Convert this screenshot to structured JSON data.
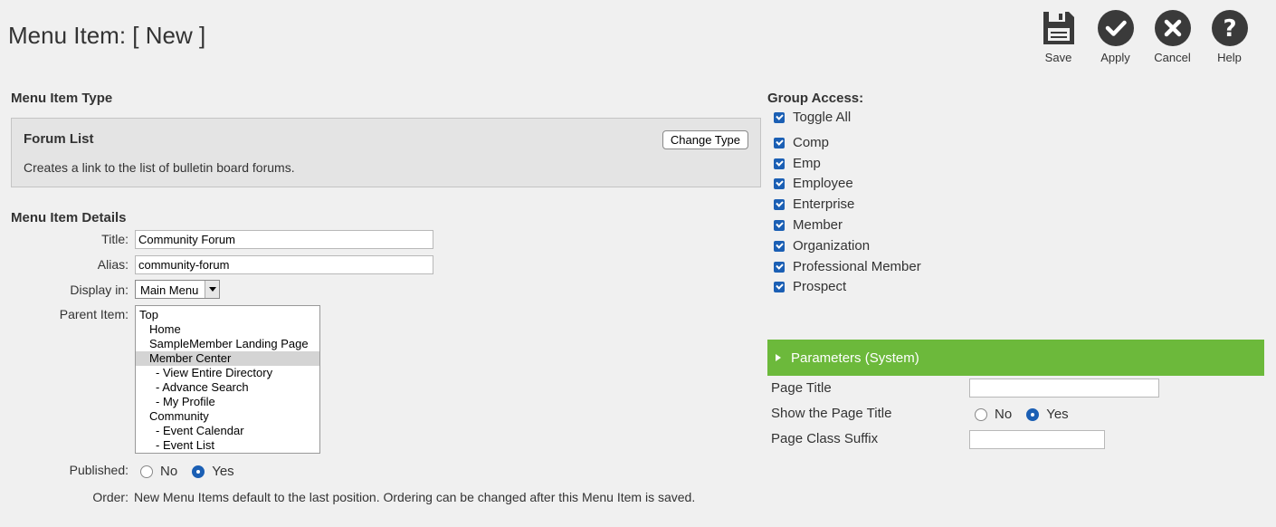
{
  "header": {
    "title": "Menu Item: [ New ]"
  },
  "toolbar": {
    "save": "Save",
    "apply": "Apply",
    "cancel": "Cancel",
    "help": "Help"
  },
  "menu_item_type": {
    "heading": "Menu Item Type",
    "name": "Forum List",
    "description": "Creates a link to the list of bulletin board forums.",
    "change_button": "Change Type"
  },
  "details": {
    "heading": "Menu Item Details",
    "title_label": "Title:",
    "title_value": "Community Forum",
    "alias_label": "Alias:",
    "alias_value": "community-forum",
    "display_label": "Display in:",
    "display_value": "Main Menu",
    "parent_label": "Parent Item:",
    "parent_items": [
      "Top",
      "Home",
      "SampleMember Landing Page",
      "Member Center",
      "- View Entire Directory",
      "- Advance Search",
      "- My Profile",
      "Community",
      "- Event Calendar",
      "- Event List"
    ],
    "parent_selected": "Member Center",
    "published_label": "Published:",
    "published_no": "No",
    "published_yes": "Yes",
    "published_value": "Yes",
    "order_label": "Order:",
    "order_text": "New Menu Items default to the last position. Ordering can be changed after this Menu Item is saved."
  },
  "group_access": {
    "heading": "Group Access:",
    "toggle_all": "Toggle All",
    "groups": [
      "Comp",
      "Emp",
      "Employee",
      "Enterprise",
      "Member",
      "Organization",
      "Professional Member",
      "Prospect"
    ]
  },
  "parameters": {
    "title": "Parameters (System)",
    "page_title_label": "Page Title",
    "page_title_value": "",
    "show_title_label": "Show the Page Title",
    "show_title_no": "No",
    "show_title_yes": "Yes",
    "show_title_value": "Yes",
    "class_suffix_label": "Page Class Suffix",
    "class_suffix_value": ""
  },
  "colors": {
    "accent_green": "#6cb93b",
    "checkbox_blue": "#1b5fb4",
    "icon_dark": "#3a3a3a"
  }
}
